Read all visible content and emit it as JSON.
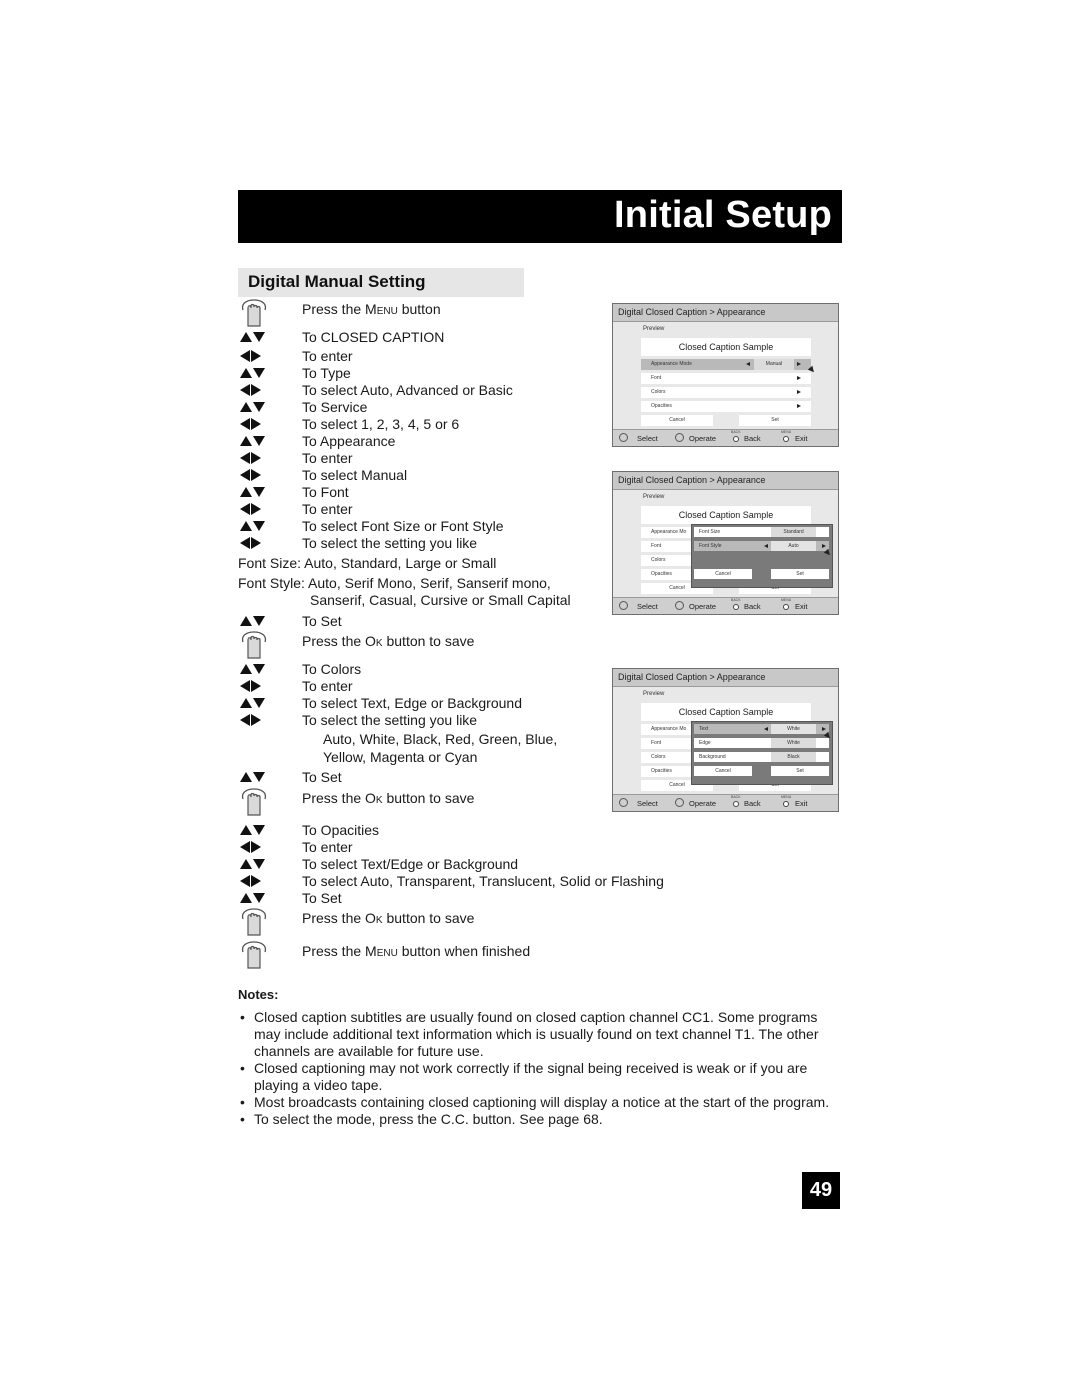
{
  "header": {
    "title": "Initial Setup"
  },
  "section": {
    "title": "Digital Manual Setting"
  },
  "steps": [
    {
      "icon": "hand-press-icon",
      "text_pre": "Press the ",
      "key": "Menu",
      "text_post": " button"
    },
    {
      "icon": "up-down-arrows-icon",
      "text": "To CLOSED CAPTION"
    },
    {
      "icon": "left-right-arrows-icon",
      "text": "To enter"
    },
    {
      "icon": "up-down-arrows-icon",
      "text": "To Type"
    },
    {
      "icon": "left-right-arrows-icon",
      "text": "To select Auto, Advanced or Basic"
    },
    {
      "icon": "up-down-arrows-icon",
      "text": "To Service"
    },
    {
      "icon": "left-right-arrows-icon",
      "text": "To select 1, 2, 3, 4, 5 or 6"
    },
    {
      "icon": "up-down-arrows-icon",
      "text": "To Appearance"
    },
    {
      "icon": "left-right-arrows-icon",
      "text": "To enter"
    },
    {
      "icon": "left-right-arrows-icon",
      "text": "To select Manual"
    },
    {
      "icon": "up-down-arrows-icon",
      "text": "To Font"
    },
    {
      "icon": "left-right-arrows-icon",
      "text": "To enter"
    },
    {
      "icon": "up-down-arrows-icon",
      "text": "To select Font Size or Font Style"
    },
    {
      "icon": "left-right-arrows-icon",
      "text": "To select the setting you like"
    },
    {
      "line": "Font Size: Auto, Standard, Large or Small"
    },
    {
      "line": "Font Style: Auto, Serif Mono, Serif, Sanserif mono,"
    },
    {
      "line_indent": "Sanserif, Casual, Cursive or Small Capital"
    },
    {
      "icon": "up-down-arrows-icon",
      "text": "To Set"
    },
    {
      "icon": "hand-press-icon",
      "text_pre": "Press the ",
      "key": "Ok",
      "text_post": " button to save"
    },
    {
      "icon": "up-down-arrows-icon",
      "text": "To Colors"
    },
    {
      "icon": "left-right-arrows-icon",
      "text": "To enter"
    },
    {
      "icon": "up-down-arrows-icon",
      "text": "To select Text, Edge or Background"
    },
    {
      "icon": "left-right-arrows-icon",
      "text": "To select the setting you like"
    },
    {
      "line_indent2": "Auto, White, Black, Red, Green, Blue,"
    },
    {
      "line_indent2": "Yellow, Magenta or Cyan"
    },
    {
      "icon": "up-down-arrows-icon",
      "text": "To Set"
    },
    {
      "icon": "hand-press-icon",
      "text_pre": "Press the ",
      "key": "Ok",
      "text_post": " button to save"
    },
    {
      "icon": "up-down-arrows-icon",
      "text": "To Opacities"
    },
    {
      "icon": "left-right-arrows-icon",
      "text": "To enter"
    },
    {
      "icon": "up-down-arrows-icon",
      "text": "To select Text/Edge or Background"
    },
    {
      "icon": "left-right-arrows-icon",
      "text": "To select Auto, Transparent, Translucent, Solid or Flashing"
    },
    {
      "icon": "up-down-arrows-icon",
      "text": "To Set"
    },
    {
      "icon": "hand-press-icon",
      "text_pre": "Press the ",
      "key": "Ok",
      "text_post": " button to save"
    },
    {
      "icon": "hand-press-icon",
      "text_pre": "Press the ",
      "key": "Menu",
      "text_post": " button when finished"
    }
  ],
  "screens": [
    {
      "breadcrumb": "Digital Closed Caption  >  Appearance",
      "preview_label": "Preview",
      "sample": "Closed Caption Sample",
      "rows": [
        {
          "label": "Appearance Mode",
          "value": "Manual",
          "selected": true
        },
        {
          "label": "Font",
          "value": ""
        },
        {
          "label": "Colors",
          "value": ""
        },
        {
          "label": "Opacities",
          "value": ""
        }
      ],
      "cancel": "Cancel",
      "set": "Set",
      "footer": {
        "select": "Select",
        "operate": "Operate",
        "back_mini": "BACK",
        "back": "Back",
        "menu_mini": "MENU",
        "exit": "Exit"
      }
    },
    {
      "breadcrumb": "Digital Closed Caption  >  Appearance",
      "preview_label": "Preview",
      "sample": "Closed Caption Sample",
      "rows": [
        {
          "label": "Appearance Mo"
        },
        {
          "label": "Font"
        },
        {
          "label": "Colors"
        },
        {
          "label": "Opacities"
        }
      ],
      "popup": [
        {
          "label": "Font Size",
          "value": "Standard",
          "selected": false
        },
        {
          "label": "Font Style",
          "value": "Auto",
          "selected": true
        }
      ],
      "popup_cancel": "Cancel",
      "popup_set": "Set",
      "cancel": "Cancel",
      "set": "Set",
      "footer": {
        "select": "Select",
        "operate": "Operate",
        "back_mini": "BACK",
        "back": "Back",
        "menu_mini": "MENU",
        "exit": "Exit"
      }
    },
    {
      "breadcrumb": "Digital Closed Caption  >  Appearance",
      "preview_label": "Preview",
      "sample": "Closed Caption Sample",
      "rows": [
        {
          "label": "Appearance Mo"
        },
        {
          "label": "Font"
        },
        {
          "label": "Colors"
        },
        {
          "label": "Opacities"
        }
      ],
      "popup": [
        {
          "label": "Text",
          "value": "White",
          "selected": true
        },
        {
          "label": "Edge",
          "value": "White",
          "selected": false
        },
        {
          "label": "Background",
          "value": "Black",
          "selected": false
        }
      ],
      "popup_cancel": "Cancel",
      "popup_set": "Set",
      "cancel": "Cancel",
      "set": "Set",
      "footer": {
        "select": "Select",
        "operate": "Operate",
        "back_mini": "BACK",
        "back": "Back",
        "menu_mini": "MENU",
        "exit": "Exit"
      }
    }
  ],
  "notes": {
    "heading": "Notes:",
    "items": [
      "Closed caption subtitles are usually found on closed caption channel CC1. Some programs may include additional text information which is usually found on text channel T1. The other channels are available for future use.",
      "Closed captioning may not work correctly if the signal being received is weak or if you are playing a video tape.",
      "Most broadcasts containing closed captioning will display a notice at the start of the program.",
      "To select the mode, press the C.C. button. See page 68."
    ]
  },
  "page_number": "49"
}
